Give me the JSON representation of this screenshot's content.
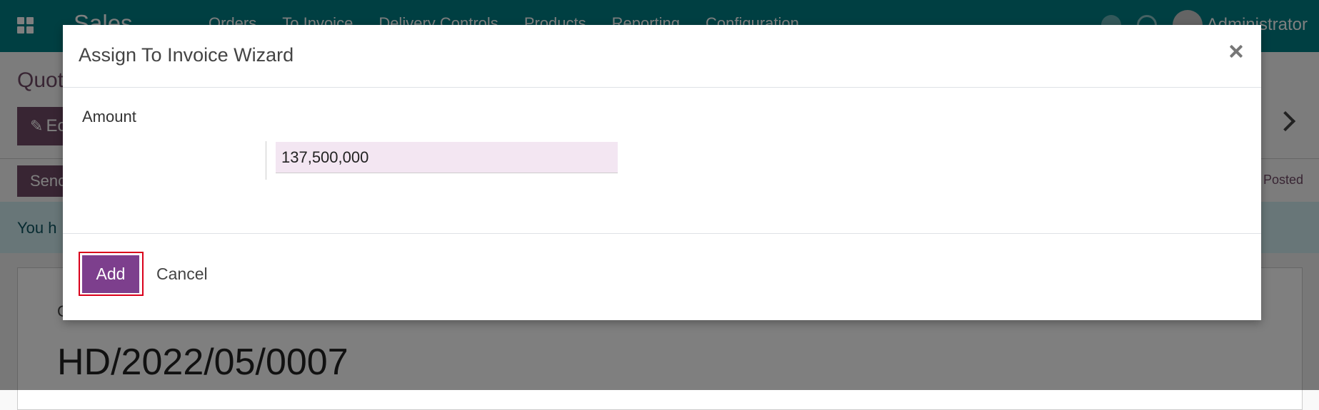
{
  "app": {
    "brand": "Sales",
    "menu": [
      "Orders",
      "To Invoice",
      "Delivery Controls",
      "Products",
      "Reporting",
      "Configuration"
    ],
    "user": "Administrator"
  },
  "background": {
    "page_title": "Quot",
    "edit_label": "Ec",
    "send_label": "Senc",
    "status_label": "Posted",
    "alert_text": "You h",
    "sheet_label": "C",
    "record_name": "HD/2022/05/0007"
  },
  "dialog": {
    "title": "Assign To Invoice Wizard",
    "field_label": "Amount",
    "amount_value": "137,500,000",
    "add_label": "Add",
    "cancel_label": "Cancel"
  },
  "colors": {
    "navbar": "#017e84",
    "primary": "#714b67",
    "add_button": "#7d3f8d",
    "input_bg": "#f3e6f2",
    "highlight": "#d9001b"
  }
}
